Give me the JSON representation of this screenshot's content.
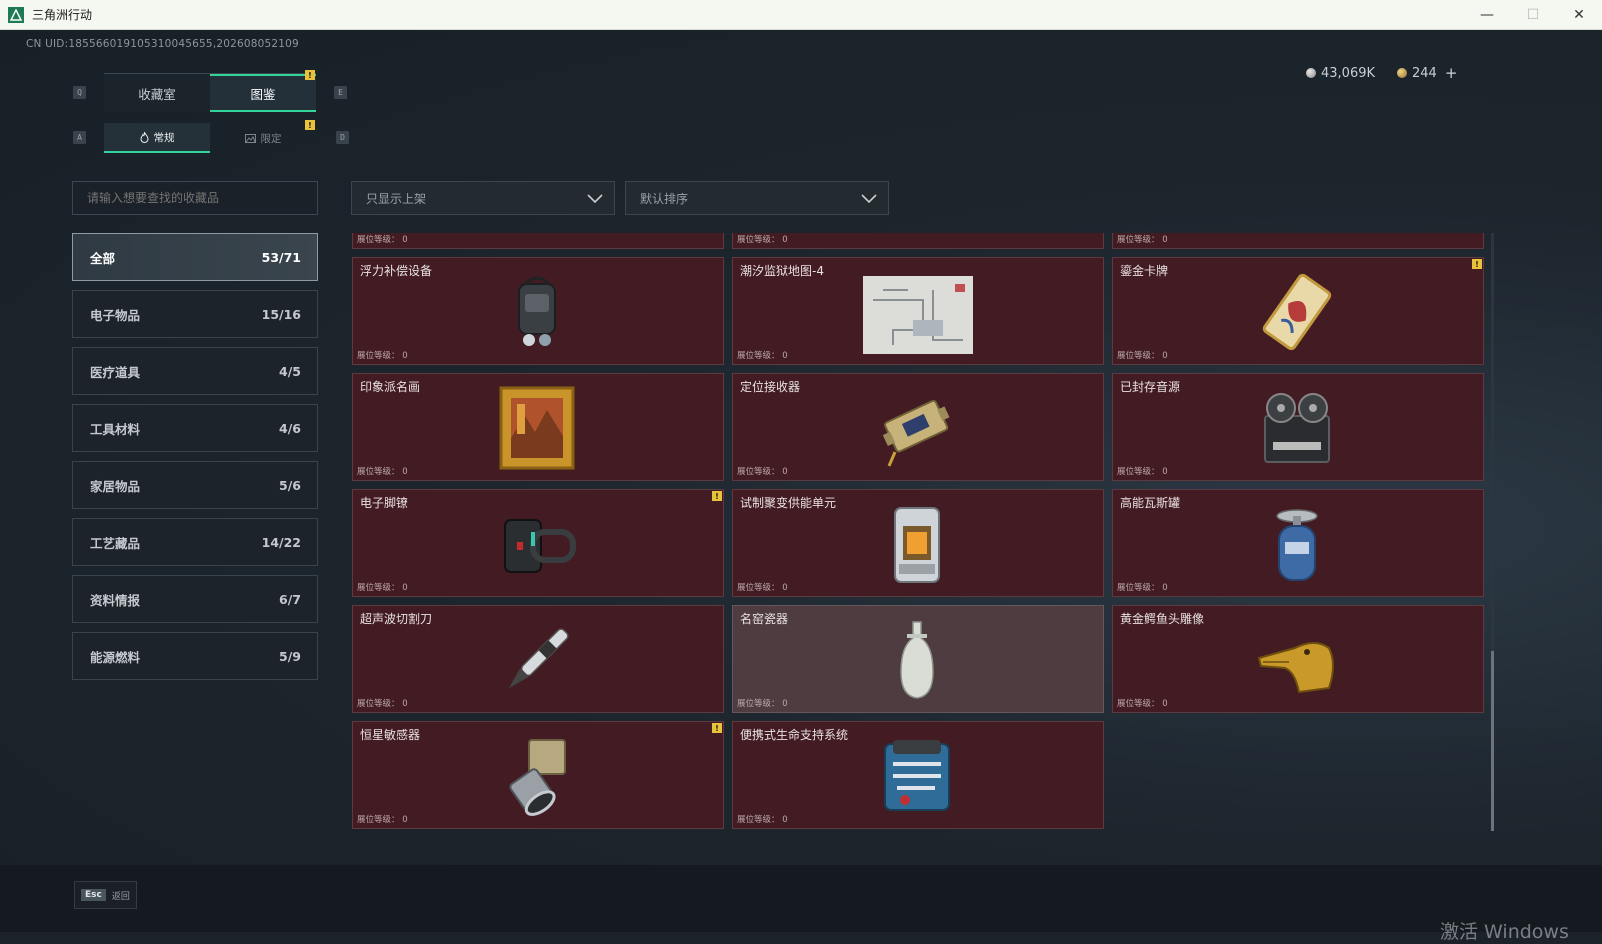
{
  "window": {
    "title": "三角洲行动",
    "minimize": "—",
    "maximize": "☐",
    "close": "✕"
  },
  "header": {
    "uid": "CN UID:18556601910531004565​5,202608052109",
    "silver": "43,069K",
    "gold": "244",
    "plus": "+"
  },
  "keys": {
    "q": "Q",
    "e": "E",
    "a": "A",
    "d": "D"
  },
  "tabs": [
    {
      "label": "收藏室"
    },
    {
      "label": "图鉴"
    }
  ],
  "subtabs": [
    {
      "label": "常规"
    },
    {
      "label": "限定"
    }
  ],
  "search": {
    "placeholder": "请输入想要查找的收藏品"
  },
  "filters": {
    "shelf": "只显示上架",
    "sort": "默认排序"
  },
  "categories": [
    {
      "label": "全部",
      "count": "53/71"
    },
    {
      "label": "电子物品",
      "count": "15/16"
    },
    {
      "label": "医疗道具",
      "count": "4/5"
    },
    {
      "label": "工具材料",
      "count": "4/6"
    },
    {
      "label": "家居物品",
      "count": "5/6"
    },
    {
      "label": "工艺藏品",
      "count": "14/22"
    },
    {
      "label": "资料情报",
      "count": "6/7"
    },
    {
      "label": "能源燃料",
      "count": "5/9"
    }
  ],
  "level_label": "展位等级：",
  "level_value": "0",
  "badge": "!",
  "items": [
    {
      "name": "",
      "level": "展位等级：  0"
    },
    {
      "name": "",
      "level": "展位等级：  0"
    },
    {
      "name": "",
      "level": "展位等级：  0"
    },
    {
      "name": "浮力补偿设备",
      "level": "展位等级：  0",
      "icon": "backpack-icon"
    },
    {
      "name": "潮汐监狱地图-4",
      "level": "展位等级：  0",
      "icon": "map-icon"
    },
    {
      "name": "鎏金卡牌",
      "level": "展位等级：  0",
      "icon": "card-icon",
      "badge": true
    },
    {
      "name": "印象派名画",
      "level": "展位等级：  0",
      "icon": "painting-icon"
    },
    {
      "name": "定位接收器",
      "level": "展位等级：  0",
      "icon": "receiver-icon"
    },
    {
      "name": "已封存音源",
      "level": "展位等级：  0",
      "icon": "tape-reel-icon"
    },
    {
      "name": "电子脚镣",
      "level": "展位等级：  0",
      "icon": "ankle-monitor-icon",
      "badge": true
    },
    {
      "name": "试制聚变供能单元",
      "level": "展位等级：  0",
      "icon": "fusion-unit-icon"
    },
    {
      "name": "高能瓦斯罐",
      "level": "展位等级：  0",
      "icon": "gas-canister-icon"
    },
    {
      "name": "超声波切割刀",
      "level": "展位等级：  0",
      "icon": "cutter-icon"
    },
    {
      "name": "名窑瓷器",
      "level": "展位等级：  0",
      "icon": "vase-icon"
    },
    {
      "name": "黄金鳄鱼头雕像",
      "level": "展位等级：  0",
      "icon": "croc-statue-icon"
    },
    {
      "name": "恒星敏感器",
      "level": "展位等级：  0",
      "icon": "star-sensor-icon",
      "badge": true
    },
    {
      "name": "便携式生命支持系统",
      "level": "展位等级：  0",
      "icon": "life-support-icon"
    }
  ],
  "footer": {
    "esc_key": "Esc",
    "back_label": "返回"
  },
  "watermark": "激活 Windows",
  "colors": {
    "accent": "#33d49b",
    "card_bg": "#431b22",
    "badge": "#e8c23a"
  }
}
